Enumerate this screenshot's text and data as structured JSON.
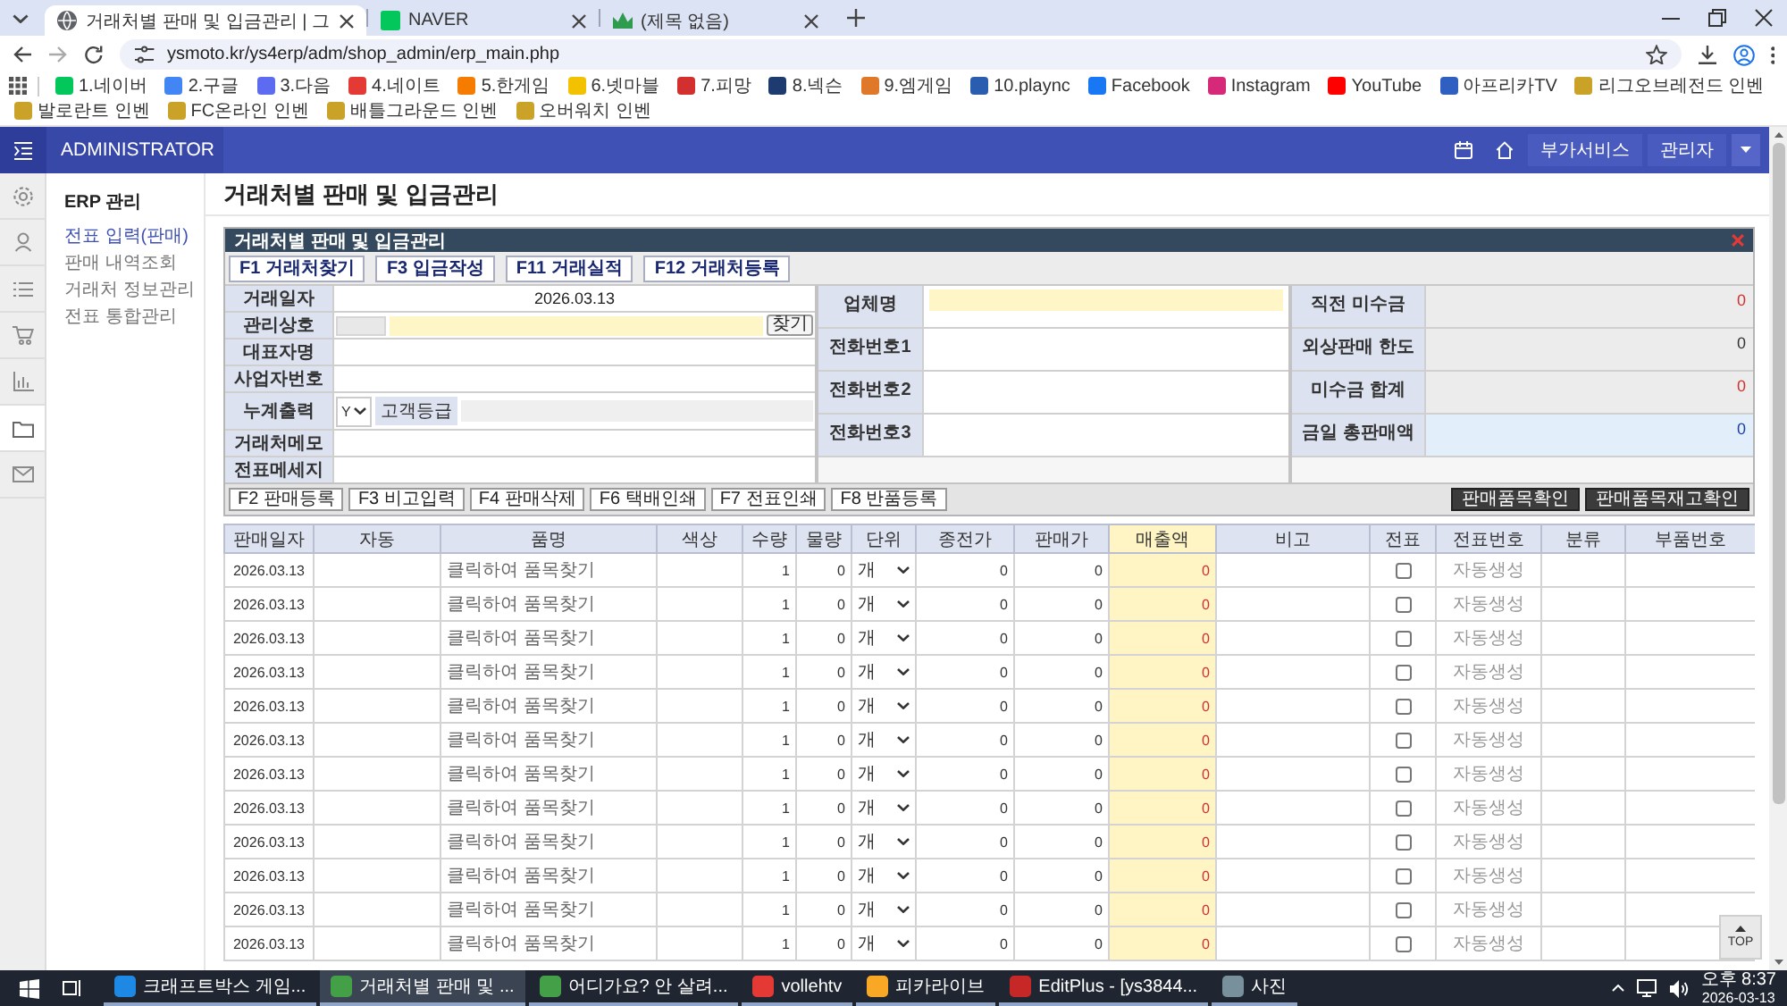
{
  "browser": {
    "tabs": [
      {
        "title": "거래처별 판매 및 입금관리 | 그",
        "selected": true
      },
      {
        "title": "NAVER",
        "selected": false
      },
      {
        "title": "(제목 없음)",
        "selected": false
      }
    ],
    "url": "ysmoto.kr/ys4erp/adm/shop_admin/erp_main.php",
    "bookmarks": [
      {
        "label": "1.네이버",
        "color": "#03c75a"
      },
      {
        "label": "2.구글",
        "color": "#4285f4"
      },
      {
        "label": "3.다음",
        "color": "#5c6bf0"
      },
      {
        "label": "4.네이트",
        "color": "#e53935"
      },
      {
        "label": "5.한게임",
        "color": "#f57c00"
      },
      {
        "label": "6.넷마블",
        "color": "#f2c200"
      },
      {
        "label": "7.피망",
        "color": "#d32f2f"
      },
      {
        "label": "8.넥슨",
        "color": "#1d3b6e"
      },
      {
        "label": "9.엠게임",
        "color": "#e0782a"
      },
      {
        "label": "10.plaync",
        "color": "#2a5db0"
      },
      {
        "label": "Facebook",
        "color": "#1877f2"
      },
      {
        "label": "Instagram",
        "color": "#d6297a"
      },
      {
        "label": "YouTube",
        "color": "#ff0000"
      },
      {
        "label": "아프리카TV",
        "color": "#2f5fc0"
      },
      {
        "label": "리그오브레전드 인벤",
        "color": "#c9a227"
      },
      {
        "label": "발로란트 인벤",
        "color": "#c9a227"
      },
      {
        "label": "FC온라인 인벤",
        "color": "#c9a227"
      },
      {
        "label": "배틀그라운드 인벤",
        "color": "#c9a227"
      },
      {
        "label": "오버워치 인벤",
        "color": "#c9a227"
      }
    ]
  },
  "header": {
    "title": "ADMINISTRATOR",
    "buttons": [
      "부가서비스",
      "관리자"
    ]
  },
  "rail": [
    {
      "selected": false
    },
    {
      "selected": false
    },
    {
      "selected": false
    },
    {
      "selected": false
    },
    {
      "selected": false
    },
    {
      "selected": true
    },
    {
      "selected": false
    }
  ],
  "sidebar": {
    "title": "ERP 관리",
    "items": [
      {
        "label": "전표 입력(판매)",
        "selected": true
      },
      {
        "label": "판매 내역조회",
        "selected": false
      },
      {
        "label": "거래처 정보관리",
        "selected": false
      },
      {
        "label": "전표 통합관리",
        "selected": false
      }
    ]
  },
  "page_title": "거래처별 판매 및 입금관리",
  "panel": {
    "title": "거래처별 판매 및 입금관리",
    "toolbar": [
      "F1 거래처찾기",
      "F3 입금작성",
      "F11 거래실적",
      "F12 거래처등록"
    ],
    "left_fields": [
      {
        "label": "거래일자",
        "kind": "text",
        "value": "2026.03.13"
      },
      {
        "label": "관리상호",
        "kind": "lookup",
        "button": "찾기"
      },
      {
        "label": "대표자명",
        "kind": "text"
      },
      {
        "label": "사업자번호",
        "kind": "text"
      },
      {
        "label": "누계출력",
        "kind": "select",
        "value": "Y",
        "sub_label": "고객등급"
      },
      {
        "label": "거래처메모",
        "kind": "text"
      },
      {
        "label": "전표메세지",
        "kind": "text"
      }
    ],
    "middle_fields": [
      {
        "label": "업체명",
        "kind": "input"
      },
      {
        "label": "전화번호1",
        "kind": "text"
      },
      {
        "label": "전화번호2",
        "kind": "text"
      },
      {
        "label": "전화번호3",
        "kind": "text"
      }
    ],
    "summary": [
      {
        "label": "직전 미수금",
        "value": "0",
        "color": "#d32f2f",
        "kind": "plain"
      },
      {
        "label": "외상판매 한도",
        "value": "0",
        "color": "#333333",
        "kind": "plain"
      },
      {
        "label": "미수금 합계",
        "value": "0",
        "color": "#d32f2f",
        "kind": "plain"
      },
      {
        "label": "금일 총판매액",
        "value": "0",
        "color": "#1a3fa8",
        "kind": "highlight"
      }
    ],
    "actions": [
      "F2 판매등록",
      "F3 비고입력",
      "F4 판매삭제",
      "F6 택배인쇄",
      "F7 전표인쇄",
      "F8 반품등록"
    ],
    "checks": [
      "판매품목확인",
      "판매품목재고확인"
    ]
  },
  "table": {
    "columns": [
      {
        "label": "판매일자",
        "highlighted": false
      },
      {
        "label": "자동",
        "highlighted": false
      },
      {
        "label": "품명",
        "highlighted": false
      },
      {
        "label": "색상",
        "highlighted": false
      },
      {
        "label": "수량",
        "highlighted": false
      },
      {
        "label": "물량",
        "highlighted": false
      },
      {
        "label": "단위",
        "highlighted": false
      },
      {
        "label": "종전가",
        "highlighted": false
      },
      {
        "label": "판매가",
        "highlighted": false
      },
      {
        "label": "매출액",
        "highlighted": true
      },
      {
        "label": "비고",
        "highlighted": false
      },
      {
        "label": "전표",
        "highlighted": false
      },
      {
        "label": "전표번호",
        "highlighted": false
      },
      {
        "label": "분류",
        "highlighted": false
      },
      {
        "label": "부품번호",
        "highlighted": false
      }
    ],
    "rows": [
      {
        "date": "2026.03.13",
        "item": "클릭하여 품목찾기",
        "qty": "1",
        "volume": "0",
        "unit": "개",
        "prev_price": "0",
        "price": "0",
        "amount": "0",
        "slip": false,
        "slip_no": "자동생성"
      },
      {
        "date": "2026.03.13",
        "item": "클릭하여 품목찾기",
        "qty": "1",
        "volume": "0",
        "unit": "개",
        "prev_price": "0",
        "price": "0",
        "amount": "0",
        "slip": false,
        "slip_no": "자동생성"
      },
      {
        "date": "2026.03.13",
        "item": "클릭하여 품목찾기",
        "qty": "1",
        "volume": "0",
        "unit": "개",
        "prev_price": "0",
        "price": "0",
        "amount": "0",
        "slip": false,
        "slip_no": "자동생성"
      },
      {
        "date": "2026.03.13",
        "item": "클릭하여 품목찾기",
        "qty": "1",
        "volume": "0",
        "unit": "개",
        "prev_price": "0",
        "price": "0",
        "amount": "0",
        "slip": false,
        "slip_no": "자동생성"
      },
      {
        "date": "2026.03.13",
        "item": "클릭하여 품목찾기",
        "qty": "1",
        "volume": "0",
        "unit": "개",
        "prev_price": "0",
        "price": "0",
        "amount": "0",
        "slip": false,
        "slip_no": "자동생성"
      },
      {
        "date": "2026.03.13",
        "item": "클릭하여 품목찾기",
        "qty": "1",
        "volume": "0",
        "unit": "개",
        "prev_price": "0",
        "price": "0",
        "amount": "0",
        "slip": false,
        "slip_no": "자동생성"
      },
      {
        "date": "2026.03.13",
        "item": "클릭하여 품목찾기",
        "qty": "1",
        "volume": "0",
        "unit": "개",
        "prev_price": "0",
        "price": "0",
        "amount": "0",
        "slip": false,
        "slip_no": "자동생성"
      },
      {
        "date": "2026.03.13",
        "item": "클릭하여 품목찾기",
        "qty": "1",
        "volume": "0",
        "unit": "개",
        "prev_price": "0",
        "price": "0",
        "amount": "0",
        "slip": false,
        "slip_no": "자동생성"
      },
      {
        "date": "2026.03.13",
        "item": "클릭하여 품목찾기",
        "qty": "1",
        "volume": "0",
        "unit": "개",
        "prev_price": "0",
        "price": "0",
        "amount": "0",
        "slip": false,
        "slip_no": "자동생성"
      },
      {
        "date": "2026.03.13",
        "item": "클릭하여 품목찾기",
        "qty": "1",
        "volume": "0",
        "unit": "개",
        "prev_price": "0",
        "price": "0",
        "amount": "0",
        "slip": false,
        "slip_no": "자동생성"
      },
      {
        "date": "2026.03.13",
        "item": "클릭하여 품목찾기",
        "qty": "1",
        "volume": "0",
        "unit": "개",
        "prev_price": "0",
        "price": "0",
        "amount": "0",
        "slip": false,
        "slip_no": "자동생성"
      },
      {
        "date": "2026.03.13",
        "item": "클릭하여 품목찾기",
        "qty": "1",
        "volume": "0",
        "unit": "개",
        "prev_price": "0",
        "price": "0",
        "amount": "0",
        "slip": false,
        "slip_no": "자동생성"
      }
    ]
  },
  "top_button": "TOP",
  "taskbar": {
    "items": [
      {
        "label": "크래프트박스 게임...",
        "color": "#1e88e5",
        "selected": false
      },
      {
        "label": "거래처별 판매 및 ...",
        "color": "#43a047",
        "selected": true
      },
      {
        "label": "어디가요? 안 살려...",
        "color": "#43a047",
        "selected": false
      },
      {
        "label": "vollehtv",
        "color": "#e53935",
        "selected": false
      },
      {
        "label": "피카라이브",
        "color": "#f9a825",
        "selected": false
      },
      {
        "label": "EditPlus - [ys3844...",
        "color": "#c62828",
        "selected": false
      },
      {
        "label": "사진",
        "color": "#78909c",
        "selected": false
      }
    ],
    "time": "오후 8:37",
    "date": "2026-03-13"
  }
}
